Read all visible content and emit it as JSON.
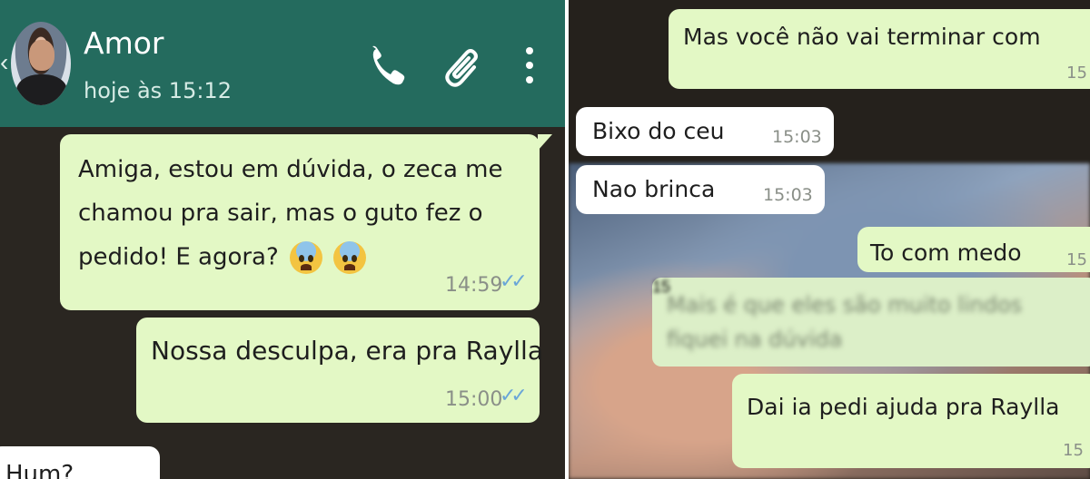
{
  "left": {
    "header": {
      "contact_name": "Amor",
      "last_seen": "hoje às 15:12",
      "colors": {
        "header_bg": "#246b5e",
        "wallpaper": "#2a2621"
      },
      "icons": [
        "back-arrow-icon",
        "phone-icon",
        "paperclip-icon",
        "more-vert-icon"
      ]
    },
    "messages": [
      {
        "direction": "out",
        "lines": [
          "Amiga, estou em dúvida, o zeca me",
          "chamou pra sair, mas o guto fez o",
          "pedido! E agora?"
        ],
        "emoji": [
          "anxious-face-icon",
          "anxious-face-icon"
        ],
        "time": "14:59",
        "status": "read"
      },
      {
        "direction": "out",
        "lines": [
          "Nossa desculpa, era pra Raylla"
        ],
        "time": "15:00",
        "status": "read"
      },
      {
        "direction": "in",
        "lines": [
          "Hum?"
        ],
        "time": "",
        "status": ""
      }
    ]
  },
  "right": {
    "messages": [
      {
        "direction": "out",
        "text": "Mas você não vai terminar com",
        "time": "15"
      },
      {
        "direction": "in",
        "text": "Bixo do ceu",
        "time": "15:03"
      },
      {
        "direction": "in",
        "text": "Nao brinca",
        "time": "15:03"
      },
      {
        "direction": "out",
        "text": "To com medo",
        "time": "15"
      },
      {
        "direction": "out",
        "text": "Mais é que eles são muito lindos",
        "text2": "fiquei na dúvida",
        "blurred": true,
        "time": "15"
      },
      {
        "direction": "out",
        "text": "Dai ia pedi ajuda pra Raylla",
        "time": "15"
      }
    ]
  },
  "colors": {
    "out_bubble": "#e3f8c5",
    "in_bubble": "#ffffff",
    "read_ticks": "#6aa6d8"
  }
}
